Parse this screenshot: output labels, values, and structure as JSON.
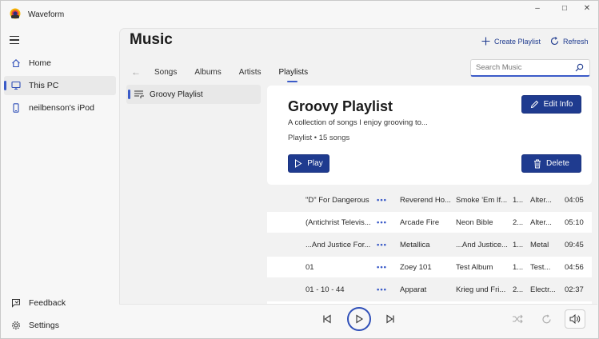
{
  "app": {
    "title": "Waveform"
  },
  "window_controls": {
    "minimize": "–",
    "maximize": "☐",
    "close": "✕"
  },
  "sidebar": {
    "items": [
      {
        "label": "Home",
        "icon": "home-icon",
        "active": false
      },
      {
        "label": "This PC",
        "icon": "monitor-icon",
        "active": true
      },
      {
        "label": "neilbenson's iPod",
        "icon": "phone-icon",
        "active": false
      }
    ],
    "bottom": [
      {
        "label": "Feedback",
        "icon": "feedback-icon"
      },
      {
        "label": "Settings",
        "icon": "gear-icon"
      }
    ]
  },
  "header": {
    "title": "Music",
    "create_playlist": "Create Playlist",
    "refresh": "Refresh"
  },
  "tabs": [
    "Songs",
    "Albums",
    "Artists",
    "Playlists"
  ],
  "active_tab": "Playlists",
  "search": {
    "placeholder": "Search Music",
    "value": ""
  },
  "playlists": [
    {
      "label": "Groovy Playlist"
    }
  ],
  "playlist": {
    "title": "Groovy Playlist",
    "description": "A collection of songs I enjoy grooving to...",
    "meta": "Playlist • 15 songs",
    "edit_label": "Edit Info",
    "play_label": "Play",
    "delete_label": "Delete"
  },
  "tracks": [
    {
      "title": "\"D\" For Dangerous",
      "more": "•••",
      "artist": "Reverend Ho...",
      "album": "Smoke 'Em If...",
      "num": "1...",
      "genre": "Alter...",
      "duration": "04:05"
    },
    {
      "title": "(Antichrist Televis...",
      "more": "•••",
      "artist": "Arcade Fire",
      "album": "Neon Bible",
      "num": "2...",
      "genre": "Alter...",
      "duration": "05:10"
    },
    {
      "title": "...And Justice For...",
      "more": "•••",
      "artist": "Metallica",
      "album": "...And Justice...",
      "num": "1...",
      "genre": "Metal",
      "duration": "09:45"
    },
    {
      "title": "01",
      "more": "•••",
      "artist": "Zoey 101",
      "album": "Test Album",
      "num": "1...",
      "genre": "Test...",
      "duration": "04:56"
    },
    {
      "title": "01 - 10 - 44",
      "more": "•••",
      "artist": "Apparat",
      "album": "Krieg und Fri...",
      "num": "2...",
      "genre": "Electr...",
      "duration": "02:37"
    }
  ],
  "colors": {
    "accent": "#1f3b8f",
    "accent_light": "#3b5bc8"
  }
}
